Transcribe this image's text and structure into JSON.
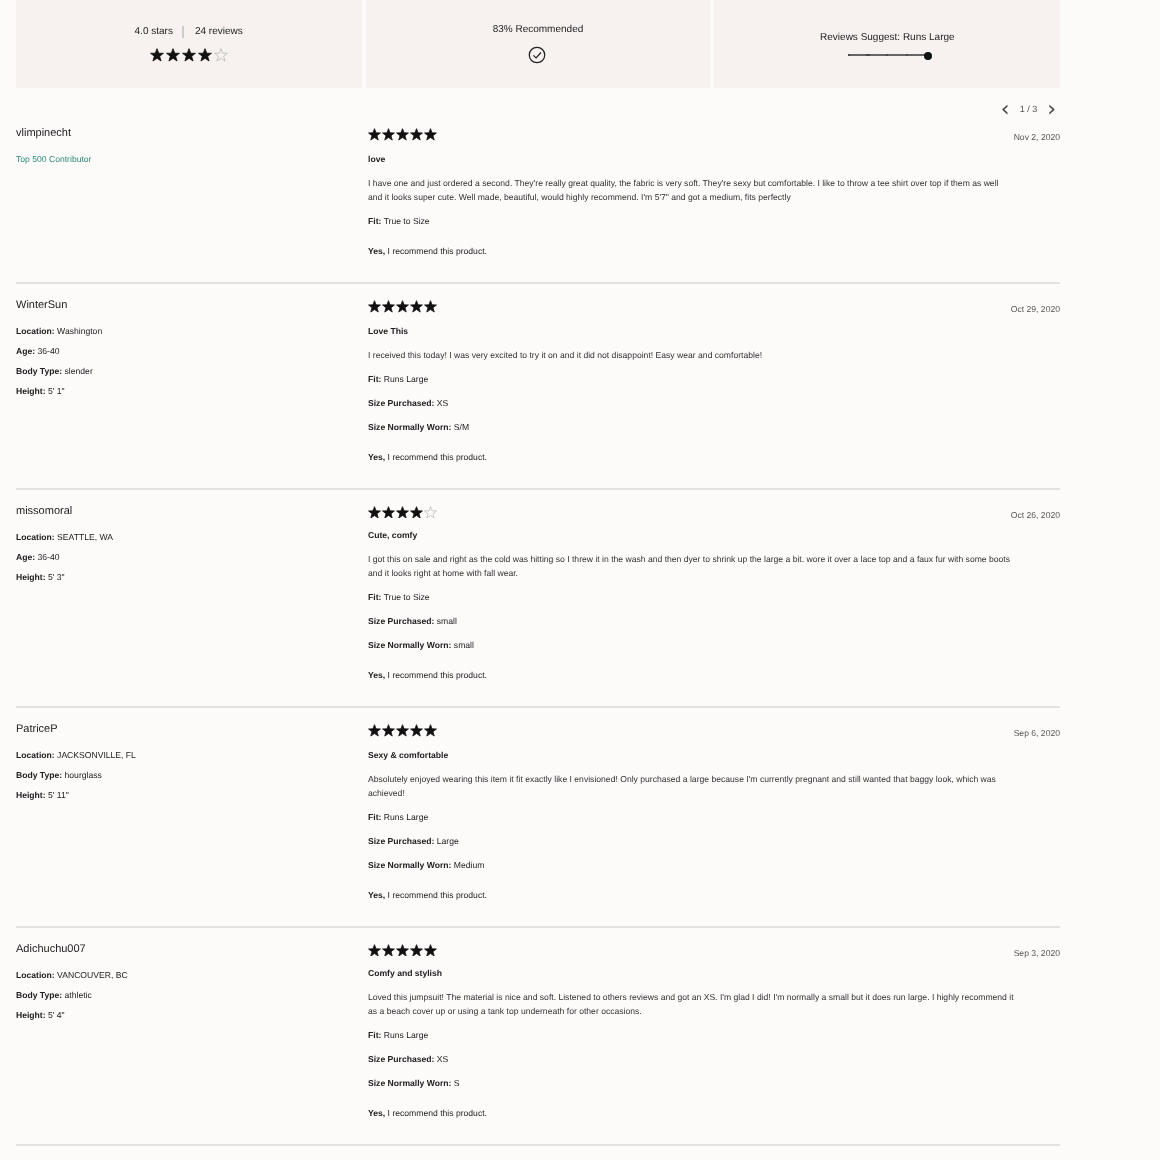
{
  "summary": {
    "rating": "4.0 stars",
    "count": "24 reviews",
    "stars": 4,
    "recommended": "83% Recommended",
    "fit_label": "Reviews Suggest: Runs Large",
    "fit": {
      "level": 1
    }
  },
  "pagination": {
    "prev": "‹",
    "page": "1 / 3",
    "next": "›"
  },
  "reviews": [
    {
      "author": "vlimpinecht",
      "badge": "Top 500 Contributor",
      "stars": 5,
      "date": "Nov 2, 2020",
      "title": "love",
      "text": "I have one and just ordered a second. They're really great quality, the fabric is very soft. They're sexy but comfortable. I like to throw a tee shirt over top if them as well and it looks super cute. Well made, beautiful, would highly recommend. I'm 5'7\" and got a medium, fits perfectly",
      "details": [
        {
          "label": "Fit:",
          "value": "True to Size"
        }
      ],
      "recommend": "**Yes,** I recommend this product."
    },
    {
      "author": "WinterSun",
      "profile": [
        {
          "label": "Location:",
          "value": "Washington"
        },
        {
          "label": "Age:",
          "value": "36-40"
        },
        {
          "label": "Body Type:",
          "value": "slender"
        },
        {
          "label": "Height:",
          "value": "5' 1\""
        }
      ],
      "stars": 5,
      "date": "Oct 29, 2020",
      "title": "Love This",
      "text": "I received this today! I was very excited to try it on and it did not disappoint! Easy wear and comfortable!",
      "details": [
        {
          "label": "Fit:",
          "value": "Runs Large"
        },
        {
          "label": "Size Purchased:",
          "value": "XS"
        },
        {
          "label": "Size Normally Worn:",
          "value": "S/M"
        }
      ],
      "recommend": "**Yes,** I recommend this product."
    },
    {
      "author": "missomoral",
      "profile": [
        {
          "label": "Location:",
          "value": "SEATTLE, WA"
        },
        {
          "label": "Age:",
          "value": "36-40"
        },
        {
          "label": "Height:",
          "value": "5' 3\""
        }
      ],
      "stars": 4,
      "date": "Oct 26, 2020",
      "title": "Cute, comfy",
      "text": "I got this on sale and right as the cold was hitting so I threw it in the wash and then dyer to shrink up the large a bit. wore it over a lace top and a faux fur with some boots and it looks right at home with fall wear.",
      "details": [
        {
          "label": "Fit:",
          "value": "True to Size"
        },
        {
          "label": "Size Purchased:",
          "value": "small"
        },
        {
          "label": "Size Normally Worn:",
          "value": "small"
        }
      ],
      "recommend": "**Yes,** I recommend this product."
    },
    {
      "author": "PatriceP",
      "profile": [
        {
          "label": "Location:",
          "value": "JACKSONVILLE, FL"
        },
        {
          "label": "Body Type:",
          "value": "hourglass"
        },
        {
          "label": "Height:",
          "value": "5' 11\""
        }
      ],
      "stars": 5,
      "date": "Sep 6, 2020",
      "title": "Sexy & comfortable",
      "text": "Absolutely enjoyed wearing this item it fit exactly like I envisioned! Only purchased a large because I'm currently pregnant and still wanted that baggy look, which was achieved!",
      "details": [
        {
          "label": "Fit:",
          "value": "Runs Large"
        },
        {
          "label": "Size Purchased:",
          "value": "Large"
        },
        {
          "label": "Size Normally Worn:",
          "value": "Medium"
        }
      ],
      "recommend": "**Yes,** I recommend this product."
    },
    {
      "author": "Adichuchu007",
      "profile": [
        {
          "label": "Location:",
          "value": "VANCOUVER, BC"
        },
        {
          "label": "Body Type:",
          "value": "athletic"
        },
        {
          "label": "Height:",
          "value": "5' 4\""
        }
      ],
      "stars": 5,
      "date": "Sep 3, 2020",
      "title": "Comfy and stylish",
      "text": "Loved this jumpsuit! The material is nice and soft. Listened to others reviews and got an XS. I'm glad I did! I'm normally a small but it does run large. I highly recommend it as a beach cover up or using a tank top underneath for other occasions.",
      "details": [
        {
          "label": "Fit:",
          "value": "Runs Large"
        },
        {
          "label": "Size Purchased:",
          "value": "XS"
        },
        {
          "label": "Size Normally Worn:",
          "value": "S"
        }
      ],
      "recommend": "**Yes,** I recommend this product."
    }
  ]
}
